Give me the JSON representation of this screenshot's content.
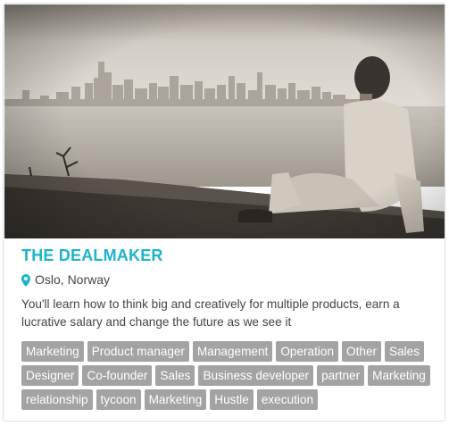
{
  "card": {
    "image_alt": "Man sitting on a seawall looking at a city skyline",
    "title": "THE DEALMAKER",
    "location": "Oslo, Norway",
    "location_icon": "map-pin-icon",
    "description": "You'll learn how to think big and creatively for multiple products, earn a lucrative salary and change the future as we see it",
    "tags": [
      "Marketing",
      "Product manager",
      "Management",
      "Operation",
      "Other",
      "Sales",
      "Designer",
      "Co-founder",
      "Sales",
      "Business developer",
      "partner",
      "Marketing",
      "relationship",
      "tycoon",
      "Marketing",
      "Hustle",
      "execution"
    ]
  },
  "colors": {
    "title": "#1ab5cb",
    "pin": "#1ab5cb",
    "tag_bg": "#a3a3a3",
    "tag_text": "#ffffff",
    "body_text": "#444444"
  }
}
